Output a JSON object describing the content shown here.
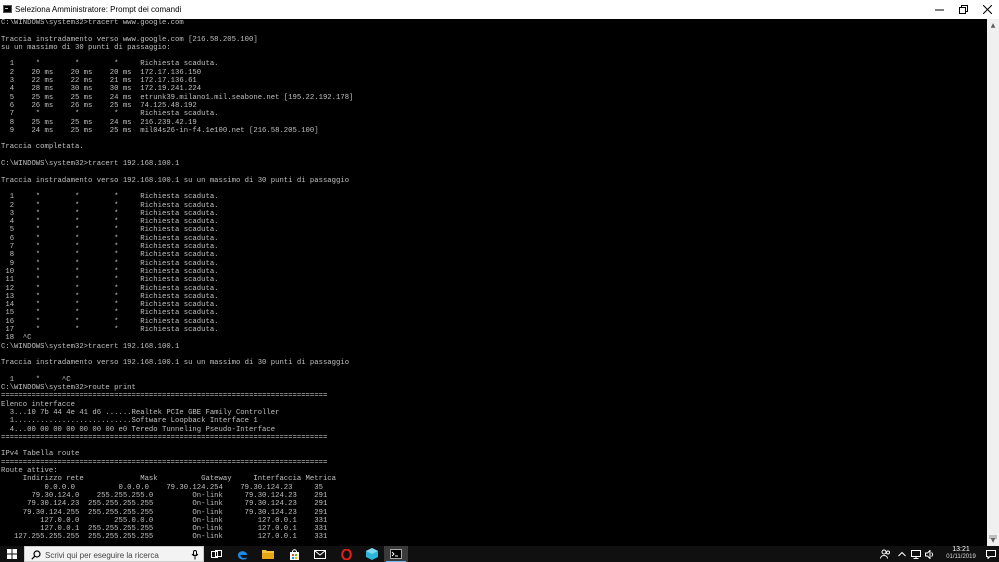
{
  "window": {
    "title": "Seleziona Amministratore: Prompt dei comandi",
    "icons": [
      "cmd-icon",
      "minimize-icon",
      "maximize-icon",
      "close-icon"
    ]
  },
  "console_lines": [
    "C:\\WINDOWS\\system32>tracert www.google.com",
    "",
    "Traccia instradamento verso www.google.com [216.58.205.100]",
    "su un massimo di 30 punti di passaggio:",
    "",
    "  1     *        *        *     Richiesta scaduta.",
    "  2    20 ms    20 ms    20 ms  172.17.136.150",
    "  3    22 ms    22 ms    21 ms  172.17.136.61",
    "  4    28 ms    30 ms    30 ms  172.19.241.224",
    "  5    25 ms    25 ms    24 ms  etrunk39.milano1.mil.seabone.net [195.22.192.178]",
    "  6    26 ms    26 ms    25 ms  74.125.48.192",
    "  7     *        *        *     Richiesta scaduta.",
    "  8    25 ms    25 ms    24 ms  216.239.42.19",
    "  9    24 ms    25 ms    25 ms  mil04s26-in-f4.1e100.net [216.58.205.100]",
    "",
    "Traccia completata.",
    "",
    "C:\\WINDOWS\\system32>tracert 192.168.100.1",
    "",
    "Traccia instradamento verso 192.168.100.1 su un massimo di 30 punti di passaggio",
    "",
    "  1     *        *        *     Richiesta scaduta.",
    "  2     *        *        *     Richiesta scaduta.",
    "  3     *        *        *     Richiesta scaduta.",
    "  4     *        *        *     Richiesta scaduta.",
    "  5     *        *        *     Richiesta scaduta.",
    "  6     *        *        *     Richiesta scaduta.",
    "  7     *        *        *     Richiesta scaduta.",
    "  8     *        *        *     Richiesta scaduta.",
    "  9     *        *        *     Richiesta scaduta.",
    " 10     *        *        *     Richiesta scaduta.",
    " 11     *        *        *     Richiesta scaduta.",
    " 12     *        *        *     Richiesta scaduta.",
    " 13     *        *        *     Richiesta scaduta.",
    " 14     *        *        *     Richiesta scaduta.",
    " 15     *        *        *     Richiesta scaduta.",
    " 16     *        *        *     Richiesta scaduta.",
    " 17     *        *        *     Richiesta scaduta.",
    " 18  ^C",
    "C:\\WINDOWS\\system32>tracert 192.168.100.1",
    "",
    "Traccia instradamento verso 192.168.100.1 su un massimo di 30 punti di passaggio",
    "",
    "  1     *     ^C",
    "C:\\WINDOWS\\system32>route print",
    "===========================================================================",
    "Elenco interfacce",
    "  3...10 7b 44 4e 41 d6 ......Realtek PCIe GBE Family Controller",
    "  1...........................Software Loopback Interface 1",
    "  4...00 00 00 00 00 00 00 e0 Teredo Tunneling Pseudo-Interface",
    "===========================================================================",
    "",
    "IPv4 Tabella route",
    "===========================================================================",
    "Route attive:",
    "     Indirizzo rete             Mask          Gateway     Interfaccia Metrica",
    "          0.0.0.0          0.0.0.0    79.30.124.254    79.30.124.23     35",
    "       79.30.124.0    255.255.255.0         On-link     79.30.124.23    291",
    "      79.30.124.23  255.255.255.255         On-link     79.30.124.23    291",
    "     79.30.124.255  255.255.255.255         On-link     79.30.124.23    291",
    "         127.0.0.0        255.0.0.0         On-link        127.0.0.1    331",
    "         127.0.0.1  255.255.255.255         On-link        127.0.0.1    331",
    "   127.255.255.255  255.255.255.255         On-link        127.0.0.1    331"
  ],
  "taskbar": {
    "search_placeholder": "Scrivi qui per eseguire la ricerca",
    "apps": [
      "task-view-icon",
      "edge-icon",
      "file-explorer-icon",
      "store-icon",
      "mail-icon",
      "opera-icon",
      "app-icon",
      "command-prompt-icon"
    ],
    "clock_time": "13:21",
    "clock_date": "01/11/2019"
  },
  "colors": {
    "console_background": "#000000",
    "console_text": "#c0c0c0",
    "titlebar": "#ffffff",
    "taskbar": "#101010",
    "accent": "#76b9ed"
  }
}
